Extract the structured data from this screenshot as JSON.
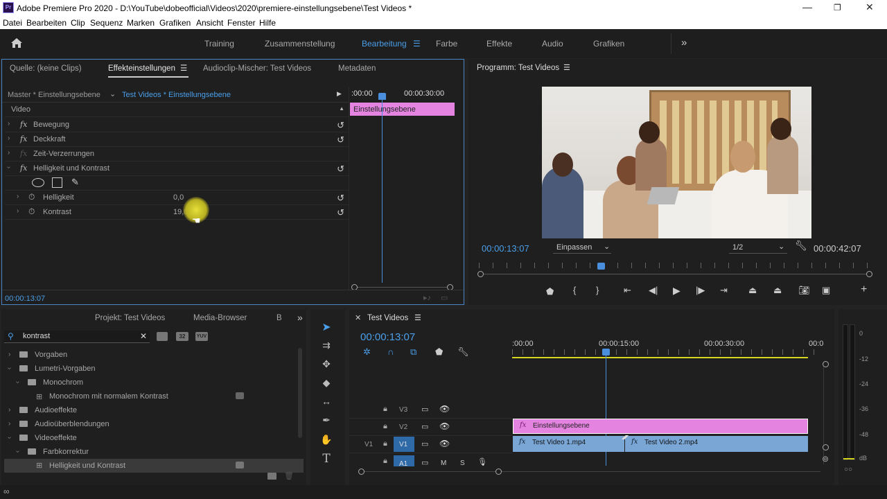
{
  "title_bar": {
    "app_title": "Adobe Premiere Pro 2020 - D:\\YouTube\\dobeofficial\\Videos\\2020\\premiere-einstellungsebene\\Test Videos *",
    "icon": "Pr"
  },
  "menu": [
    "Datei",
    "Bearbeiten",
    "Clip",
    "Sequenz",
    "Marken",
    "Grafiken",
    "Ansicht",
    "Fenster",
    "Hilfe"
  ],
  "workspaces": [
    "Training",
    "Zusammenstellung",
    "Bearbeitung",
    "Farbe",
    "Effekte",
    "Audio",
    "Grafiken"
  ],
  "active_workspace": "Bearbeitung",
  "source_panel": {
    "tabs": [
      "Quelle: (keine Clips)",
      "Effekteinstellungen",
      "Audioclip-Mischer: Test Videos",
      "Metadaten"
    ],
    "master": "Master * Einstellungsebene",
    "clip": "Test Videos * Einstellungsebene",
    "time_start": ":00:00",
    "time_end": "00:00:30:00",
    "clip_bar": "Einstellungsebene",
    "section": "Video",
    "effects": [
      {
        "name": "Bewegung",
        "fx": "fx"
      },
      {
        "name": "Deckkraft",
        "fx": "fx"
      },
      {
        "name": "Zeit-Verzerrungen",
        "fx": "fx"
      },
      {
        "name": "Helligkeit und Kontrast",
        "fx": "fx"
      }
    ],
    "params": [
      {
        "name": "Helligkeit",
        "value": "0,0"
      },
      {
        "name": "Kontrast",
        "value": "19,0"
      }
    ],
    "timecode": "00:00:13:07"
  },
  "program": {
    "title": "Programm: Test Videos",
    "timecode": "00:00:13:07",
    "fit": "Einpassen",
    "quality": "1/2",
    "duration": "00:00:42:07"
  },
  "project": {
    "tabs": [
      "Projekt: Test Videos",
      "Media-Browser",
      "B"
    ],
    "search": "kontrast",
    "badges": [
      "32",
      "YUV"
    ],
    "items": [
      {
        "label": "Vorgaben",
        "level": 0,
        "open": false
      },
      {
        "label": "Lumetri-Vorgaben",
        "level": 0,
        "open": true
      },
      {
        "label": "Monochrom",
        "level": 1,
        "open": true
      },
      {
        "label": "Monochrom mit normalem Kontrast",
        "level": 2,
        "open": false
      },
      {
        "label": "Audioeffekte",
        "level": 0,
        "open": false
      },
      {
        "label": "Audioüberblendungen",
        "level": 0,
        "open": false
      },
      {
        "label": "Videoeffekte",
        "level": 0,
        "open": true
      },
      {
        "label": "Farbkorrektur",
        "level": 1,
        "open": true
      },
      {
        "label": "Helligkeit und Kontrast",
        "level": 2,
        "open": false
      }
    ]
  },
  "timeline": {
    "title": "Test Videos",
    "timecode": "00:00:13:07",
    "ruler": [
      ":00:00",
      "00:00:15:00",
      "00:00:30:00",
      "00:0"
    ],
    "tracks": [
      {
        "name": "V3"
      },
      {
        "name": "V2"
      },
      {
        "name": "V1",
        "source": "V1"
      },
      {
        "name": "A1"
      }
    ],
    "clips": {
      "v2": "Einstellungsebene",
      "v1a": "Test Video 1.mp4",
      "v1b": "Test Video 2.mp4"
    },
    "fx": "fx"
  },
  "audio_meter": {
    "scale": [
      "0",
      "-12",
      "-24",
      "-36",
      "-48",
      "dB"
    ]
  }
}
